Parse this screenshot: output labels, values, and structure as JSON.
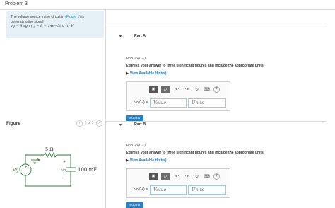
{
  "header": {
    "title": "Problem 3"
  },
  "problem": {
    "line1": "The voltage source in the circuit in ",
    "figure_link": "(Figure 1)",
    "line1_end": " is",
    "line2": "generating the signal",
    "signal": "vg = 8 sgn (t) − 8 + 14e−5t u (t) V"
  },
  "figure": {
    "label": "Figure",
    "pager": "1 of 1",
    "prev_icon": "‹",
    "next_icon": "›",
    "resistor_label": "5 Ω",
    "current_label": "io",
    "source_label": "vg",
    "cap_voltage_label": "vo",
    "cap_label": "100 mF",
    "plus": "+",
    "minus": "−"
  },
  "parts": [
    {
      "label": "Part A",
      "find_prefix": "Find ",
      "find_expr": "vo(0−)",
      "find_suffix": ".",
      "instruction": "Express your answer to three significant figures and include the appropriate units.",
      "hints": "View Available Hint(s)",
      "eq_label": "vo(0−) =",
      "value_placeholder": "Value",
      "units_placeholder": "Units",
      "submit": "Submit"
    },
    {
      "label": "Part B",
      "find_prefix": "Find ",
      "find_expr": "vo(0+)",
      "find_suffix": ".",
      "instruction": "Express your answer to three significant figures and include the appropriate units.",
      "hints": "View Available Hint(s)",
      "eq_label": "vo(0+) =",
      "value_placeholder": "Value",
      "units_placeholder": "Units",
      "submit": "Submit"
    }
  ],
  "toolbar": {
    "template_icon": "▣",
    "units_label": "μA",
    "undo_icon": "↶",
    "redo_icon": "↷",
    "reset_icon": "↻",
    "keyboard_icon": "⌨",
    "help_icon": "?"
  },
  "colors": {
    "accent": "#2a7fc1",
    "problem_bg": "#e6f1f7",
    "circuit": "#2e7d32"
  }
}
